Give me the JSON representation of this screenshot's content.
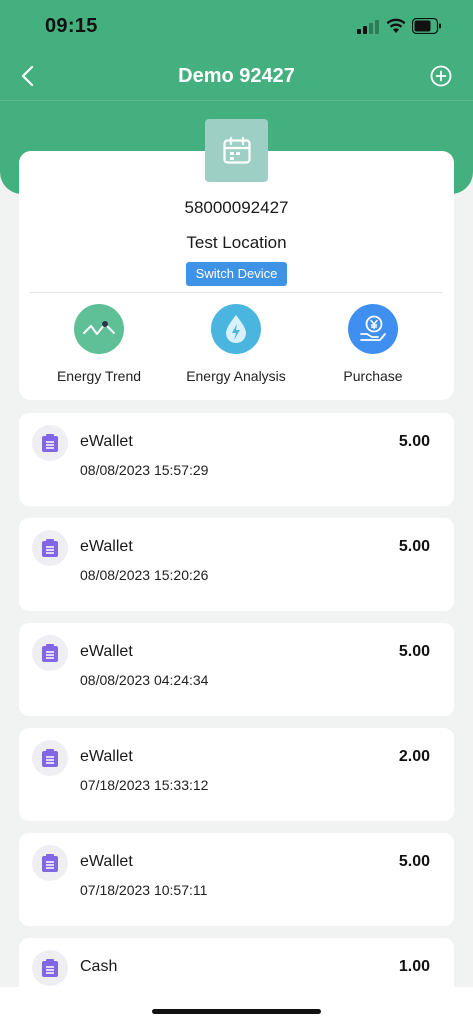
{
  "status_bar": {
    "time": "09:15"
  },
  "nav": {
    "title": "Demo 92427",
    "back_icon": "chevron-left-icon",
    "add_icon": "plus-circle-icon"
  },
  "device": {
    "icon": "calendar-icon",
    "id": "58000092427",
    "location": "Test Location",
    "switch_label": "Switch Device"
  },
  "actions": [
    {
      "label": "Energy Trend",
      "icon": "trend-line-icon",
      "color": "#5fbf97"
    },
    {
      "label": "Energy Analysis",
      "icon": "energy-drop-icon",
      "color": "#4ab6e0"
    },
    {
      "label": "Purchase",
      "icon": "yen-hand-icon",
      "color": "#3f8ff0"
    }
  ],
  "transactions": [
    {
      "type": "eWallet",
      "date": "08/08/2023 15:57:29",
      "amount": "5.00"
    },
    {
      "type": "eWallet",
      "date": "08/08/2023 15:20:26",
      "amount": "5.00"
    },
    {
      "type": "eWallet",
      "date": "08/08/2023 04:24:34",
      "amount": "5.00"
    },
    {
      "type": "eWallet",
      "date": "07/18/2023 15:33:12",
      "amount": "2.00"
    },
    {
      "type": "eWallet",
      "date": "07/18/2023 10:57:11",
      "amount": "5.00"
    },
    {
      "type": "Cash",
      "date": "",
      "amount": "1.00"
    }
  ],
  "colors": {
    "header": "#45b07f",
    "switch_button": "#3f93e6",
    "tx_icon": "#8266e8"
  }
}
